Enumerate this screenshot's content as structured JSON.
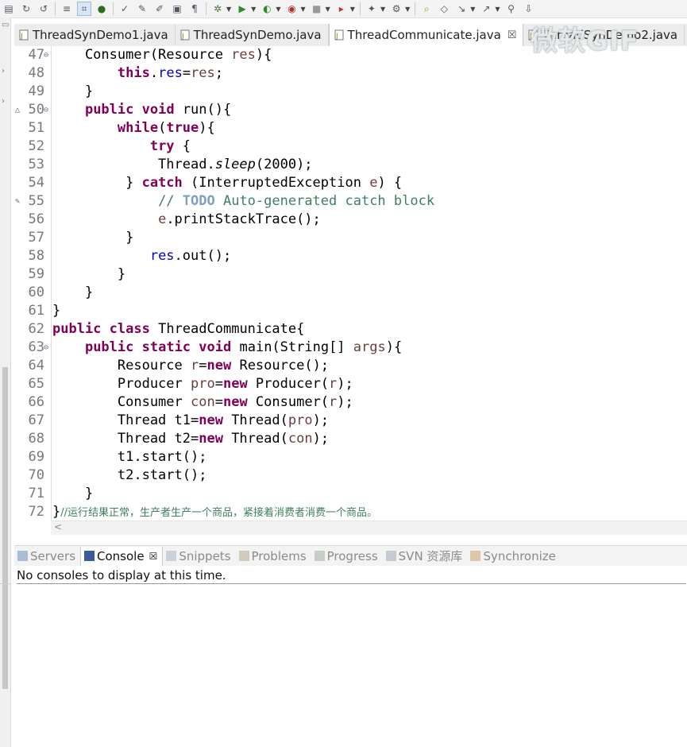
{
  "toolbar": {
    "icons": [
      "save-icon",
      "redo-icon",
      "reload-icon",
      "toggle-mark-occurrences-icon",
      "toggle-block-selection-icon",
      "spring-icon",
      "spell-check-icon",
      "pen-icon",
      "edit-icon",
      "toggle-breadcrumb-icon",
      "show-whitespace-icon",
      "debug-icon",
      "run-icon",
      "coverage-icon",
      "external-tools-icon",
      "stop-icon",
      "deploy-icon",
      "new-wizard-icon",
      "open-type-icon",
      "search-icon",
      "open-task-icon",
      "next-annotation-icon",
      "prev-annotation-icon",
      "pin-icon",
      "last-edit-icon"
    ]
  },
  "tabs": [
    {
      "label": "ThreadSynDemo1.java",
      "active": false
    },
    {
      "label": "ThreadSynDemo.java",
      "active": false
    },
    {
      "label": "ThreadCommunicate.java",
      "active": true,
      "close": "☒"
    },
    {
      "label": "ThreadSynDemo2.java",
      "active": false
    }
  ],
  "editor": {
    "lines": [
      {
        "n": "47",
        "fold": "⊖",
        "marker": "",
        "code": "    Consumer(Resource res){"
      },
      {
        "n": "48",
        "fold": "",
        "marker": "",
        "code": "        this.res=res;"
      },
      {
        "n": "49",
        "fold": "",
        "marker": "",
        "code": "    }"
      },
      {
        "n": "50",
        "fold": "⊖",
        "marker": "△",
        "code": "    public void run(){"
      },
      {
        "n": "51",
        "fold": "",
        "marker": "",
        "code": "        while(true){"
      },
      {
        "n": "52",
        "fold": "",
        "marker": "",
        "code": "            try {"
      },
      {
        "n": "53",
        "fold": "",
        "marker": "",
        "code": "             Thread.sleep(2000);"
      },
      {
        "n": "54",
        "fold": "",
        "marker": "",
        "code": "         } catch (InterruptedException e) {"
      },
      {
        "n": "55",
        "fold": "",
        "marker": "✎",
        "code": "             // TODO Auto-generated catch block"
      },
      {
        "n": "56",
        "fold": "",
        "marker": "",
        "code": "             e.printStackTrace();"
      },
      {
        "n": "57",
        "fold": "",
        "marker": "",
        "code": "         }"
      },
      {
        "n": "58",
        "fold": "",
        "marker": "",
        "code": "            res.out();"
      },
      {
        "n": "59",
        "fold": "",
        "marker": "",
        "code": "        }"
      },
      {
        "n": "60",
        "fold": "",
        "marker": "",
        "code": "    }"
      },
      {
        "n": "61",
        "fold": "",
        "marker": "",
        "code": "}"
      },
      {
        "n": "62",
        "fold": "",
        "marker": "",
        "code": "public class ThreadCommunicate{"
      },
      {
        "n": "63",
        "fold": "⊖",
        "marker": "",
        "code": "    public static void main(String[] args){"
      },
      {
        "n": "64",
        "fold": "",
        "marker": "",
        "code": "        Resource r=new Resource();"
      },
      {
        "n": "65",
        "fold": "",
        "marker": "",
        "code": "        Producer pro=new Producer(r);"
      },
      {
        "n": "66",
        "fold": "",
        "marker": "",
        "code": "        Consumer con=new Consumer(r);"
      },
      {
        "n": "67",
        "fold": "",
        "marker": "",
        "code": "        Thread t1=new Thread(pro);"
      },
      {
        "n": "68",
        "fold": "",
        "marker": "",
        "code": "        Thread t2=new Thread(con);"
      },
      {
        "n": "69",
        "fold": "",
        "marker": "",
        "code": "        t1.start();"
      },
      {
        "n": "70",
        "fold": "",
        "marker": "",
        "code": "        t2.start();"
      },
      {
        "n": "71",
        "fold": "",
        "marker": "",
        "code": "    }"
      },
      {
        "n": "72",
        "fold": "",
        "marker": "",
        "code": "}//运行结果正常，生产者生产一个商品，紧接着消费者消费一个商品。"
      }
    ],
    "scroll_arrow": "<"
  },
  "panel": {
    "tabs": [
      {
        "label": "Servers",
        "icon": "servers-icon",
        "color": "#6b8fbf",
        "active": false
      },
      {
        "label": "Console",
        "icon": "console-icon",
        "color": "#3a5a9c",
        "active": true,
        "close": "☒"
      },
      {
        "label": "Snippets",
        "icon": "snippets-icon",
        "color": "#a9b4c6",
        "active": false
      },
      {
        "label": "Problems",
        "icon": "problems-icon",
        "color": "#b7a98b",
        "active": false
      },
      {
        "label": "Progress",
        "icon": "progress-icon",
        "color": "#9fb0a0",
        "active": false
      },
      {
        "label": "SVN 资源库",
        "icon": "svn-repository-icon",
        "color": "#a0a8b8",
        "active": false
      },
      {
        "label": "Synchronize",
        "icon": "synchronize-icon",
        "color": "#c7a46b",
        "active": false
      }
    ]
  },
  "console": {
    "message": "No consoles to display at this time."
  },
  "watermark": {
    "text": "微软GIF"
  },
  "colors": {
    "keyword": "#7f0055",
    "field": "#0000c0",
    "variable": "#6a3e3e",
    "comment": "#3f7f5f",
    "todo": "#7f9fbf"
  }
}
